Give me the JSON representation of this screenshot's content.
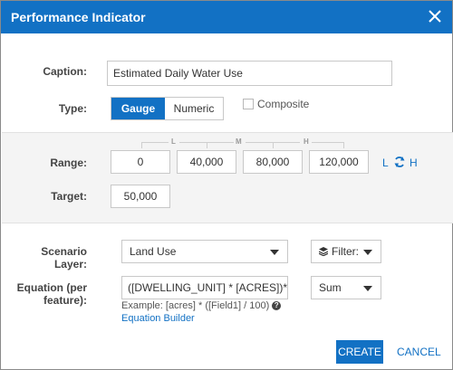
{
  "dialog": {
    "title": "Performance Indicator",
    "close_icon": "close-icon"
  },
  "caption": {
    "label": "Caption:",
    "value": "Estimated Daily Water Use"
  },
  "type": {
    "label": "Type:",
    "options": [
      "Gauge",
      "Numeric"
    ],
    "selected": "Gauge",
    "composite_label": "Composite"
  },
  "range": {
    "label": "Range:",
    "tick_labels": [
      "L",
      "M",
      "H"
    ],
    "values": [
      "0",
      "40,000",
      "80,000",
      "120,000"
    ],
    "low_link": "L",
    "high_link": "H",
    "swap_icon": "refresh-icon"
  },
  "target": {
    "label": "Target:",
    "value": "50,000"
  },
  "scenario": {
    "label": "Scenario Layer:",
    "value": "Land Use",
    "filter_label": "Filter:",
    "filter_icon": "layers-icon"
  },
  "equation": {
    "label_line1": "Equation (per",
    "label_line2": "feature):",
    "value": "([DWELLING_UNIT] * [ACRES])*[WAT",
    "aggregate": "Sum",
    "example": "Example: [acres] * ([Field1] / 100)",
    "builder_link": "Equation Builder"
  },
  "footer": {
    "create": "CREATE",
    "cancel": "CANCEL"
  },
  "colors": {
    "accent": "#1271c4",
    "band": "#f4f4f4"
  }
}
